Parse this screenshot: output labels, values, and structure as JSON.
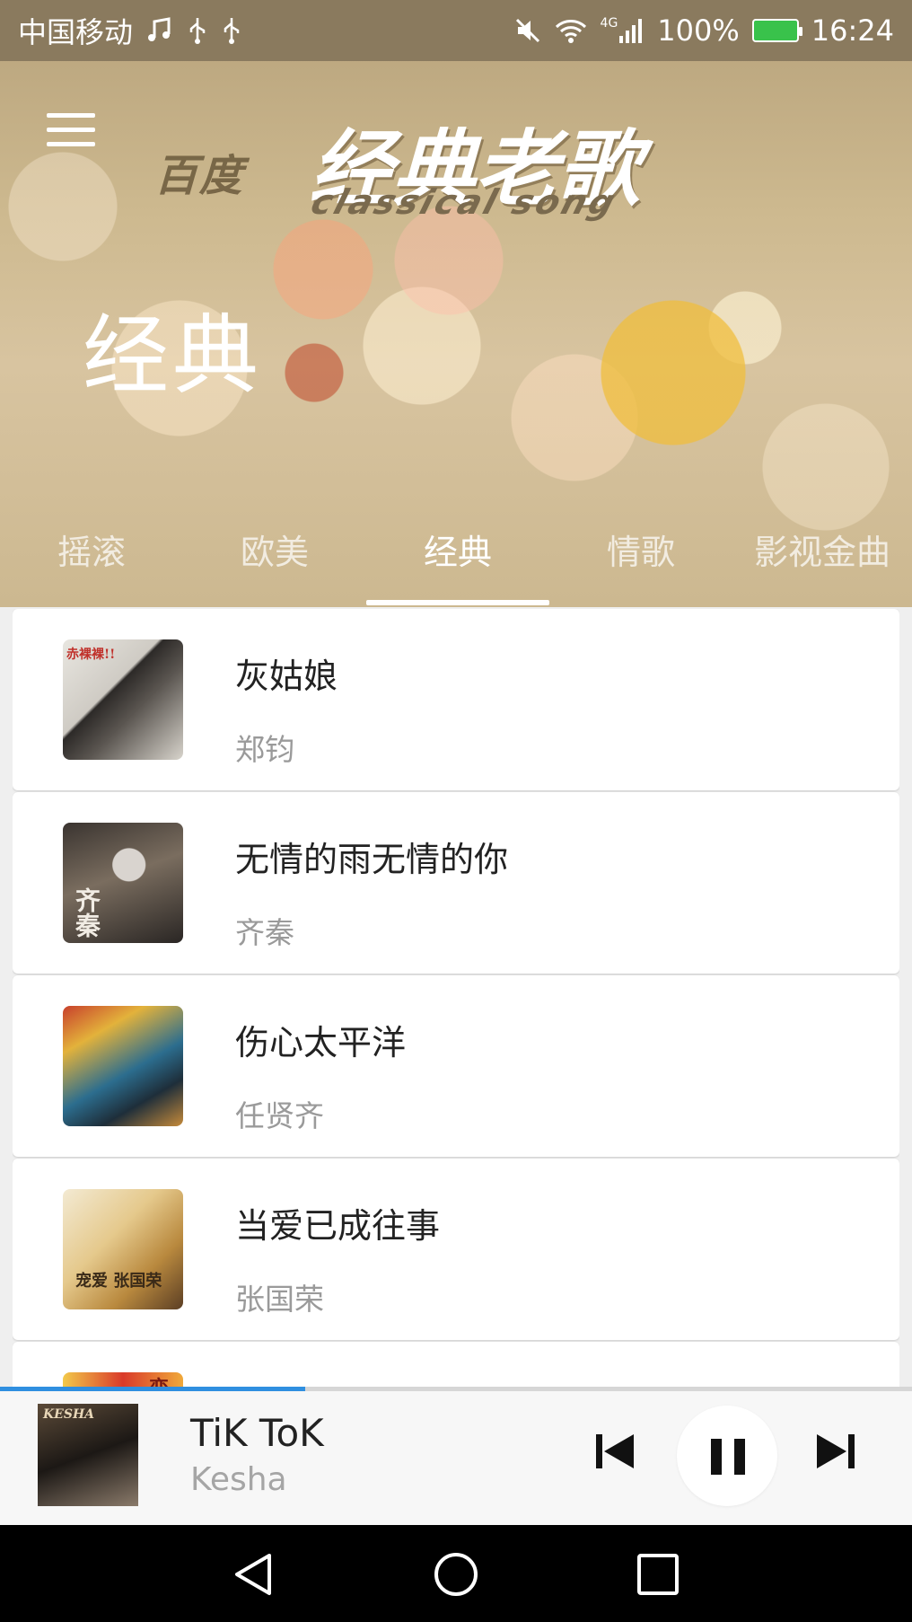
{
  "statusbar": {
    "carrier": "中国移动",
    "network": "4G",
    "battery": "100%",
    "time": "16:24"
  },
  "header": {
    "logo_prefix": "百度",
    "logo_main": "经典老歌",
    "logo_sub": "classical song",
    "title": "经典"
  },
  "tabs": [
    {
      "label": "摇滚",
      "active": false
    },
    {
      "label": "欧美",
      "active": false
    },
    {
      "label": "经典",
      "active": true
    },
    {
      "label": "情歌",
      "active": false
    },
    {
      "label": "影视金曲",
      "active": false
    }
  ],
  "songs": [
    {
      "title": "灰姑娘",
      "artist": "郑钧",
      "cover_text": "赤裸裸!!"
    },
    {
      "title": "无情的雨无情的你",
      "artist": "齐秦",
      "cover_text": "齐秦"
    },
    {
      "title": "伤心太平洋",
      "artist": "任贤齐",
      "cover_text": ""
    },
    {
      "title": "当爱已成往事",
      "artist": "张国荣",
      "cover_text": "宠爱 张国荣"
    },
    {
      "title": "",
      "artist": "",
      "cover_text": "恋"
    }
  ],
  "player": {
    "title": "TiK ToK",
    "artist": "Kesha",
    "cover_text": "KESHA",
    "progress_fraction": 0.335
  },
  "icons": {
    "menu": "hamburger-menu-icon",
    "prev": "skip-previous-icon",
    "pause": "pause-icon",
    "next": "skip-next-icon",
    "back": "nav-back-icon",
    "home": "nav-home-icon",
    "recents": "nav-recents-icon"
  },
  "colors": {
    "accent": "#2f8fe0",
    "battery": "#39c24b"
  }
}
